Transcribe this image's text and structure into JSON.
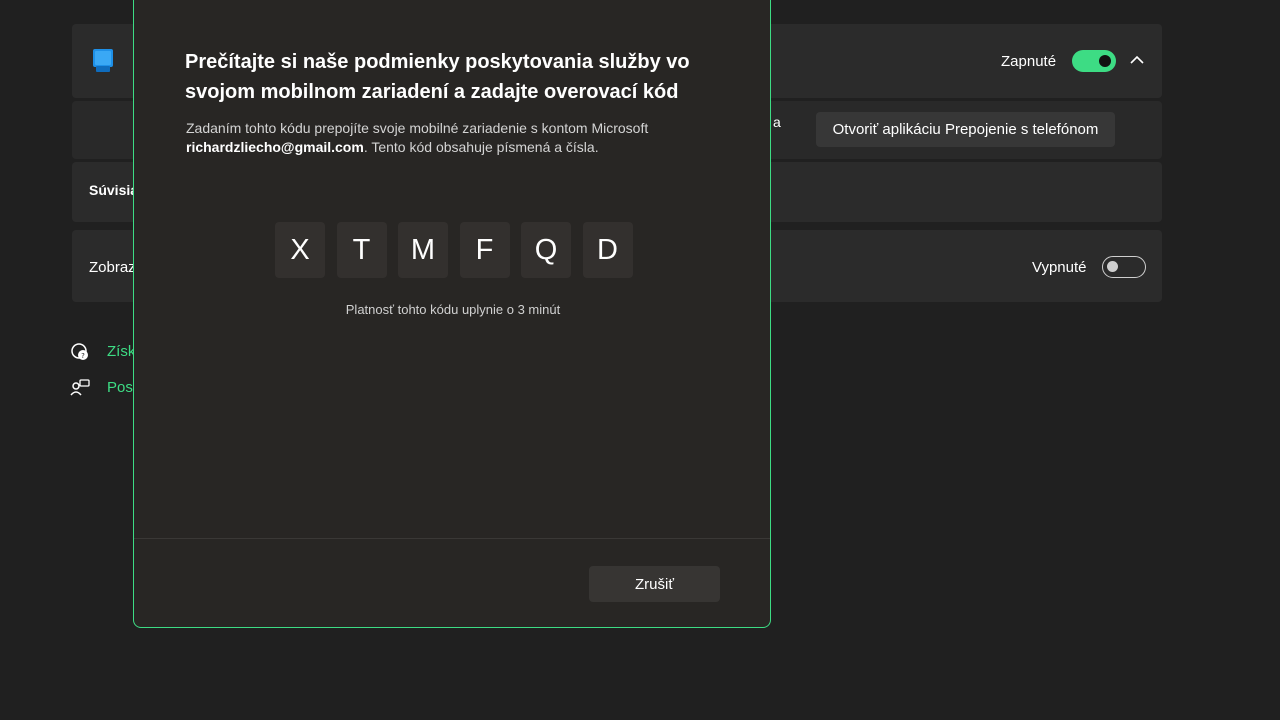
{
  "settings": {
    "top_card": {
      "toggle_label": "Zapnuté",
      "toggle_state": "on"
    },
    "sub_card": {
      "partial_text": "a",
      "open_app_button": "Otvoriť aplikáciu Prepojenie s telefónom"
    },
    "related": {
      "heading_partial": "Súvisia"
    },
    "show_card": {
      "label_partial": "Zobraz",
      "toggle_label": "Vypnuté",
      "toggle_state": "off"
    },
    "links": [
      {
        "label_partial": "Získ",
        "icon": "help-icon"
      },
      {
        "label_partial": "Posl",
        "icon": "feedback-icon"
      }
    ]
  },
  "dialog": {
    "title": "Prečítajte si naše podmienky poskytovania služby vo svojom mobilnom zariadení a zadajte overovací kód",
    "description_before": "Zadaním tohto kódu prepojíte svoje mobilné zariadenie s kontom Microsoft",
    "email": "richardzliecho@gmail.com",
    "description_after": ". Tento kód obsahuje písmená a čísla.",
    "code": [
      "X",
      "T",
      "M",
      "F",
      "Q",
      "D"
    ],
    "expiry_text": "Platnosť tohto kódu uplynie o 3 minút",
    "cancel_button": "Zrušiť"
  },
  "colors": {
    "accent": "#3ddc84",
    "background": "#202020",
    "card": "#2b2b2b",
    "dialog": "#282624"
  }
}
